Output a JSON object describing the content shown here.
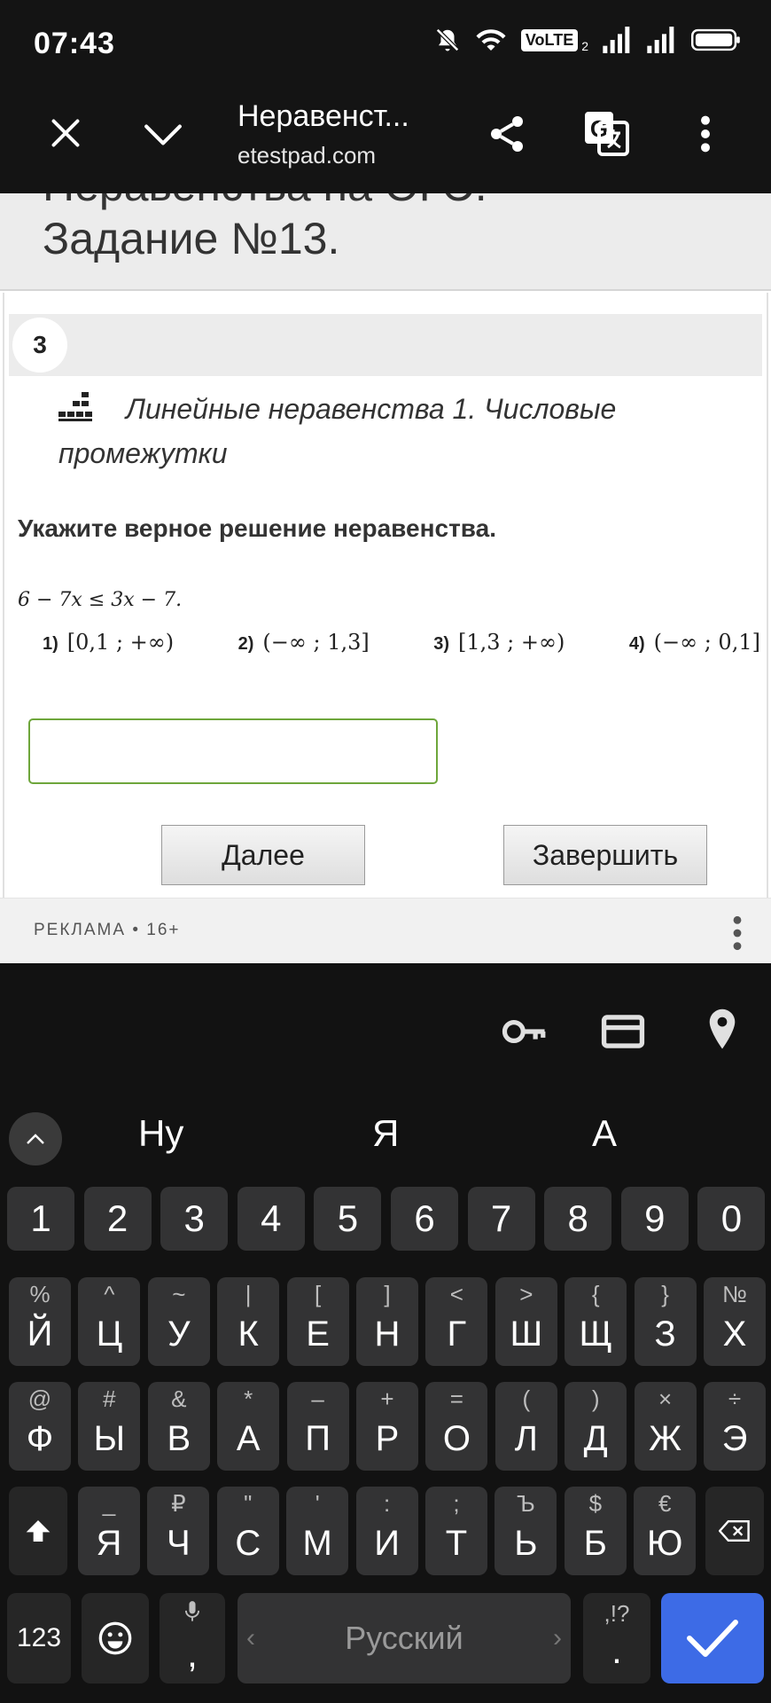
{
  "status_bar": {
    "time": "07:43",
    "volte": "VoLTE",
    "sim_index": "2"
  },
  "browser": {
    "title": "Неравенст...",
    "host": "etestpad.com"
  },
  "page": {
    "heading_cut": "Неравенства на ОГЭ.",
    "heading": "Задание №13.",
    "question_number": "3",
    "topic": "Линейные неравенства 1. Числовые промежутки",
    "instruction": "Укажите верное решение неравенства.",
    "inequality": "6 − 7x ≤ 3x − 7.",
    "options": [
      {
        "num": "1)",
        "text": "[0,1 ;  +∞)"
      },
      {
        "num": "2)",
        "text": "(−∞ ; 1,3]"
      },
      {
        "num": "3)",
        "text": "[1,3 ;  +∞)"
      },
      {
        "num": "4)",
        "text": "(−∞ ; 0,1]"
      }
    ],
    "answer_value": "",
    "next_button": "Далее",
    "finish_button": "Завершить",
    "ad_label": "РЕКЛАМА • 16+"
  },
  "keyboard": {
    "suggestions": [
      "Ну",
      "Я",
      "А"
    ],
    "digits": [
      "1",
      "2",
      "3",
      "4",
      "5",
      "6",
      "7",
      "8",
      "9",
      "0"
    ],
    "row1": [
      {
        "alt": "%",
        "key": "Й"
      },
      {
        "alt": "^",
        "key": "Ц"
      },
      {
        "alt": "~",
        "key": "У"
      },
      {
        "alt": "|",
        "key": "К"
      },
      {
        "alt": "[",
        "key": "Е"
      },
      {
        "alt": "]",
        "key": "Н"
      },
      {
        "alt": "<",
        "key": "Г"
      },
      {
        "alt": ">",
        "key": "Ш"
      },
      {
        "alt": "{",
        "key": "Щ"
      },
      {
        "alt": "}",
        "key": "З"
      },
      {
        "alt": "№",
        "key": "Х"
      }
    ],
    "row2": [
      {
        "alt": "@",
        "key": "Ф"
      },
      {
        "alt": "#",
        "key": "Ы"
      },
      {
        "alt": "&",
        "key": "В"
      },
      {
        "alt": "*",
        "key": "А"
      },
      {
        "alt": "–",
        "key": "П"
      },
      {
        "alt": "+",
        "key": "Р"
      },
      {
        "alt": "=",
        "key": "О"
      },
      {
        "alt": "(",
        "key": "Л"
      },
      {
        "alt": ")",
        "key": "Д"
      },
      {
        "alt": "×",
        "key": "Ж"
      },
      {
        "alt": "÷",
        "key": "Э"
      }
    ],
    "row3": [
      {
        "alt": "_",
        "key": "Я"
      },
      {
        "alt": "₽",
        "key": "Ч"
      },
      {
        "alt": "\"",
        "key": "С"
      },
      {
        "alt": "'",
        "key": "М"
      },
      {
        "alt": ":",
        "key": "И"
      },
      {
        "alt": ";",
        "key": "Т"
      },
      {
        "alt": "Ъ",
        "key": "Ь"
      },
      {
        "alt": "$",
        "key": "Б"
      },
      {
        "alt": "€",
        "key": "Ю"
      }
    ],
    "symbols_key": "123",
    "comma_key": ",",
    "space_label": "Русский",
    "period_alt": ",!?",
    "period_key": "."
  }
}
